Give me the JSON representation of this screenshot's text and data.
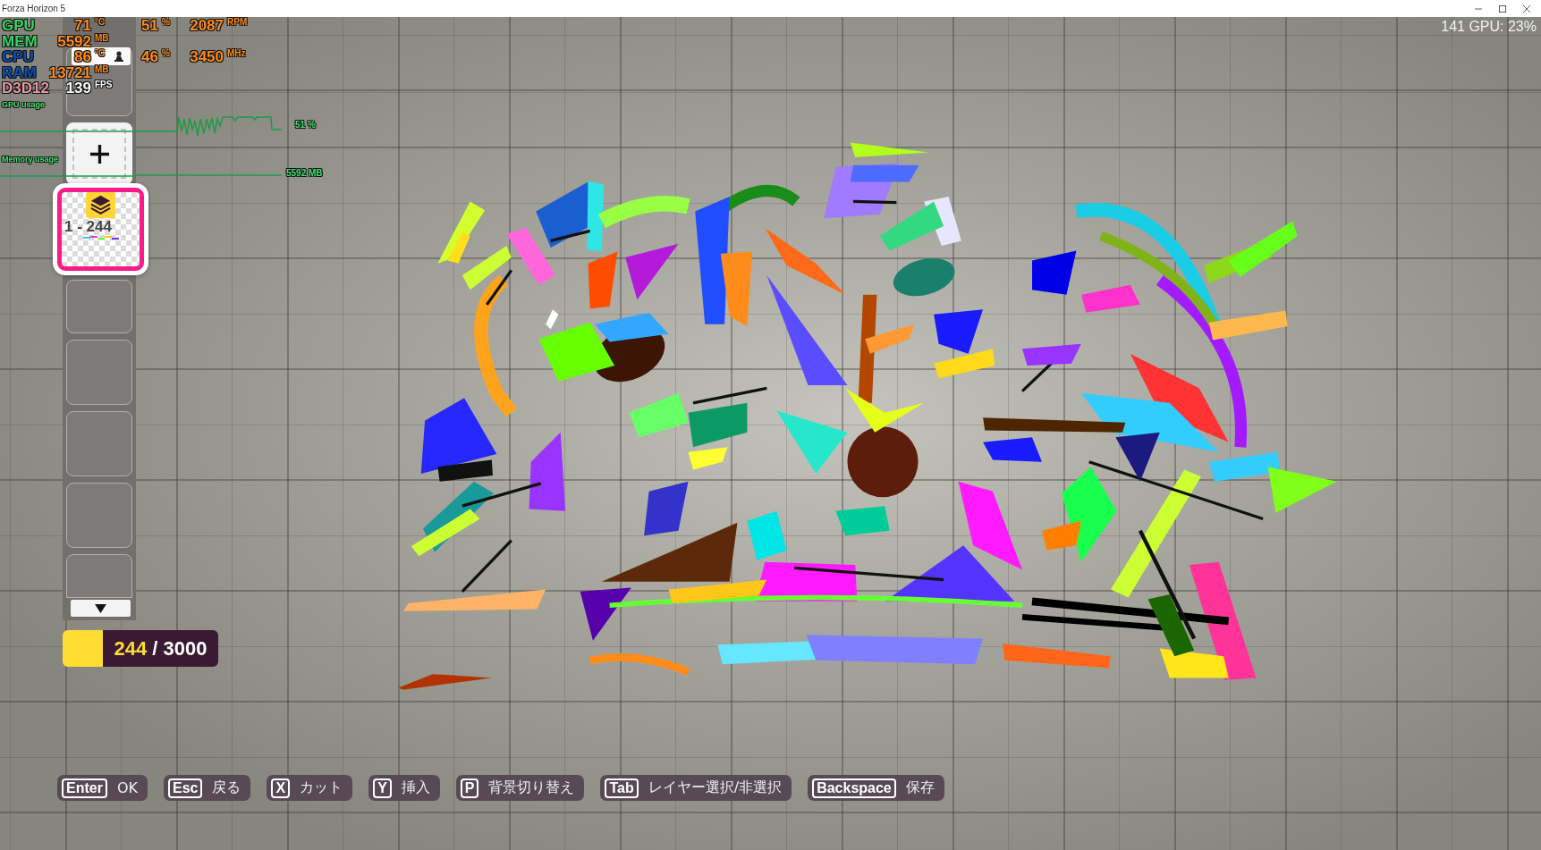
{
  "window": {
    "title": "Forza Horizon 5"
  },
  "perf_overlay": {
    "rows": [
      {
        "label": "GPU",
        "color": "#36d463",
        "kind": "sensor",
        "readings": [
          {
            "value": "71",
            "unit": "°C"
          },
          {
            "value": "51",
            "unit": "%"
          },
          {
            "value": "2087",
            "unit": "RPM"
          }
        ]
      },
      {
        "label": "MEM",
        "color": "#36d463",
        "kind": "sensor",
        "readings": [
          {
            "value": "5592",
            "unit": "MB"
          }
        ]
      },
      {
        "label": "CPU",
        "color": "#0d4fb0",
        "kind": "sensor",
        "readings": [
          {
            "value": "86",
            "unit": "°C"
          },
          {
            "value": "46",
            "unit": "%"
          },
          {
            "value": "3450",
            "unit": "MHz"
          }
        ]
      },
      {
        "label": "RAM",
        "color": "#0d4fb0",
        "kind": "sensor",
        "readings": [
          {
            "value": "13721",
            "unit": "MB"
          }
        ]
      },
      {
        "label": "D3D12",
        "color": "#e597a2",
        "kind": "framerate",
        "readings": [
          {
            "value": "139",
            "unit": "FPS"
          }
        ]
      }
    ],
    "graphs": [
      {
        "label": "GPU usage",
        "reading": "51 %",
        "kind": "spiky"
      },
      {
        "label": "Memory usage",
        "reading": "5592 MB",
        "kind": "flat"
      }
    ]
  },
  "fps_readout": "141 GPU: 23%",
  "layers": {
    "items": [
      {
        "kind": "collapsed",
        "selected": false
      },
      {
        "kind": "add",
        "selected": false
      },
      {
        "kind": "group",
        "label": "1 - 244",
        "selected": true
      },
      {
        "kind": "empty",
        "selected": false
      },
      {
        "kind": "empty",
        "selected": false
      },
      {
        "kind": "empty",
        "selected": false
      },
      {
        "kind": "empty",
        "selected": false
      },
      {
        "kind": "empty",
        "selected": false
      }
    ]
  },
  "layer_count": {
    "count": "244",
    "total": "/ 3000"
  },
  "key_hints": [
    {
      "key": "Enter",
      "label": "OK"
    },
    {
      "key": "Esc",
      "label": "戻る"
    },
    {
      "key": "X",
      "label": "カット"
    },
    {
      "key": "Y",
      "label": "挿入"
    },
    {
      "key": "P",
      "label": "背景切り替え"
    },
    {
      "key": "Tab",
      "label": "レイヤー選択/非選択"
    },
    {
      "key": "Backspace",
      "label": "保存"
    }
  ]
}
